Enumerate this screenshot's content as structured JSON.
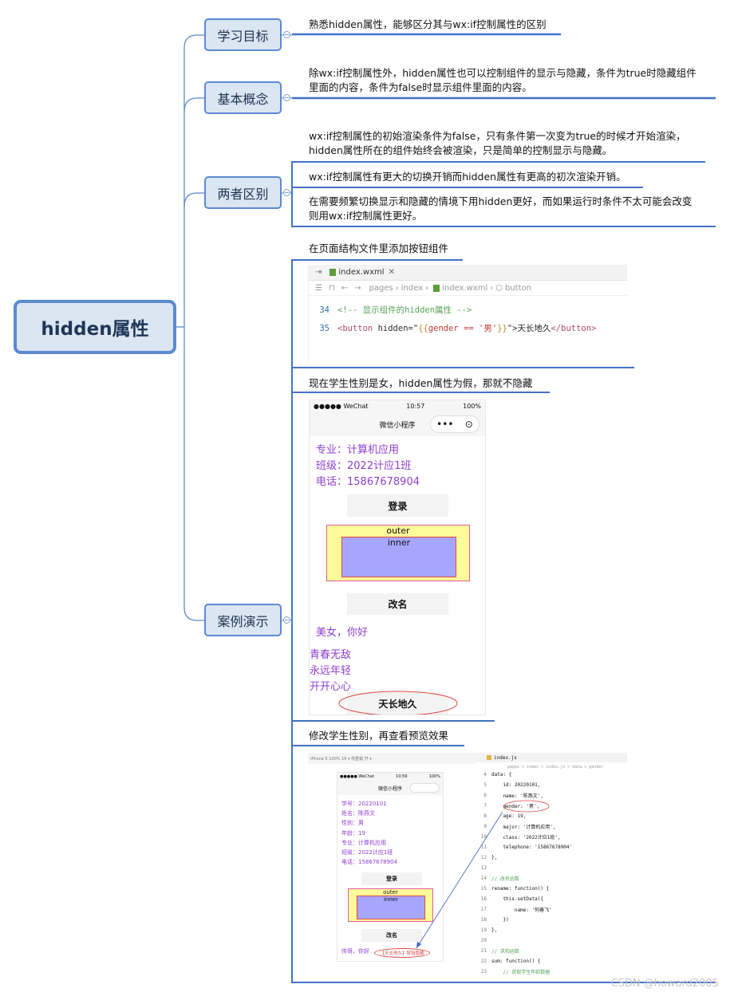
{
  "root": {
    "title": "hidden属性"
  },
  "branches": [
    {
      "label": "学习目标"
    },
    {
      "label": "基本概念"
    },
    {
      "label": "两者区别"
    },
    {
      "label": "案例演示"
    }
  ],
  "leaves": {
    "goal": "熟悉hidden属性，能够区分其与wx:if控制属性的区别",
    "concept_1": "除wx:if控制属性外，hidden属性也可以控制组件的显示与隐藏，条件为true时隐藏组件",
    "concept_2": "里面的内容，条件为false时显示组件里面的内容。",
    "diff1_1": "wx:if控制属性的初始渲染条件为false，只有条件第一次变为true的时候才开始渲染，",
    "diff1_2": "hidden属性所在的组件始终会被渲染，只是简单的控制显示与隐藏。",
    "diff2": "wx:if控制属性有更大的切换开销而hidden属性有更高的初次渲染开销。",
    "diff3_1": "在需要频繁切换显示和隐藏的情境下用hidden更好，而如果运行时条件不太可能会改变",
    "diff3_2": "则用wx:if控制属性更好。",
    "demo1": "在页面结构文件里添加按钮组件",
    "demo2": "现在学生性别是女，hidden属性为假，那就不隐藏",
    "demo3": "修改学生性别，再查看预览效果"
  },
  "editor": {
    "tab_name": "index.wxml",
    "breadcrumb": [
      "pages",
      "index",
      "index.wxml",
      "button"
    ],
    "lines": [
      {
        "no": "34",
        "comment": "<!-- 显示组件的hidden属性 -->"
      },
      {
        "no": "35",
        "open": "<button",
        "attr": " hidden=\"",
        "expr_open": "{{",
        "expr": "gender == '男'",
        "expr_close": "}}",
        "attr_end": "\">",
        "text": "天长地久",
        "close": "</button>"
      }
    ]
  },
  "phone1": {
    "carrier": "●●●●● WeChat",
    "time": "10:57",
    "battery": "100%",
    "title": "微信小程序",
    "capsule_dots": "•••",
    "capsule_close": "⊙",
    "info": [
      "专业：计算机应用",
      "班级：2022计应1班",
      "电话：15867678904"
    ],
    "login_btn": "登录",
    "outer": "outer",
    "inner": "inner",
    "rename_btn": "改名",
    "greeting": "美女，你好",
    "list": [
      "青春无敌",
      "永远年轻",
      "开开心心"
    ],
    "forever_btn": "天长地久"
  },
  "shot2": {
    "toolbar": "iPhone 5 100% 16 ▾    热重载 开 ▾",
    "phone": {
      "carrier": "●●●●● WeChat",
      "time": "10:59",
      "battery": "100%",
      "title": "微信小程序",
      "info": [
        "学号：20220101",
        "姓名：陈燕文",
        "性别：男",
        "年龄：19",
        "专业：计算机应用",
        "班级：2022计应1班",
        "电话：15867678904"
      ],
      "login_btn": "登录",
      "outer": "outer",
      "inner": "inner",
      "rename_btn": "改名",
      "greeting": "帅哥，你好",
      "hidden_note": "【天长地久】按钮隐藏"
    },
    "code": {
      "tab": "index.js",
      "crumb": "pages > index > index.js > data > gender",
      "lines": [
        {
          "no": "4",
          "text": "data: {"
        },
        {
          "no": "5",
          "text": "    id: 20220101,"
        },
        {
          "no": "6",
          "text": "    name: '陈燕文',"
        },
        {
          "no": "7",
          "text": "    gender: '男',"
        },
        {
          "no": "8",
          "text": "    age: 19,"
        },
        {
          "no": "9",
          "text": "    major: '计算机应用',"
        },
        {
          "no": "10",
          "text": "    class: '2022计应1班',"
        },
        {
          "no": "11",
          "text": "    telephone: '15867678904'"
        },
        {
          "no": "12",
          "text": "},"
        },
        {
          "no": "13",
          "text": ""
        },
        {
          "no": "14",
          "text": "// 改名函数"
        },
        {
          "no": "15",
          "text": "rename: function() {"
        },
        {
          "no": "16",
          "text": "    this.setData({"
        },
        {
          "no": "17",
          "text": "        name: '何善飞'"
        },
        {
          "no": "18",
          "text": "    })"
        },
        {
          "no": "19",
          "text": "},"
        },
        {
          "no": "20",
          "text": ""
        },
        {
          "no": "21",
          "text": "// 求和函数"
        },
        {
          "no": "22",
          "text": "sum: function() {"
        },
        {
          "no": "23",
          "text": "    // 获取学生年龄数据"
        }
      ]
    }
  },
  "watermark": "CSDN @howard2005",
  "colors": {
    "accent": "#5b8ad1",
    "node_fill": "#dbe6f3",
    "leaf_line": "#4472c4",
    "purple_text": "#8e3fd0",
    "highlight_ellipse": "#e04848"
  }
}
